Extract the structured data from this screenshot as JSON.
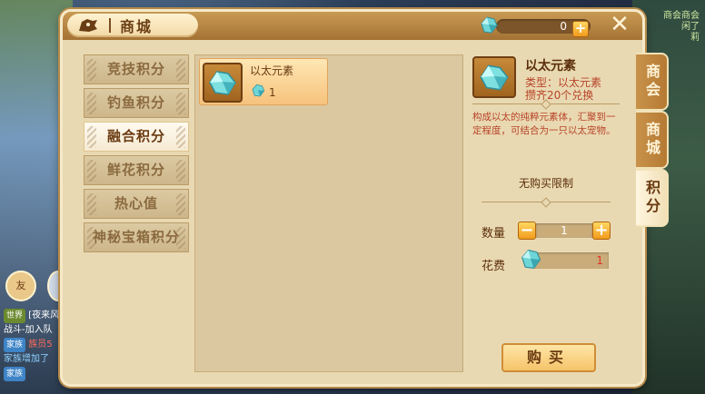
{
  "background": {
    "avatar_label": "友",
    "top_right_lines": [
      "商会商会",
      "闲了",
      "莉"
    ],
    "chat": [
      {
        "tag": "世界",
        "text": "[夜来风",
        "tag_type": "world"
      },
      {
        "tag": "",
        "text": "战斗-加入队",
        "tag_type": ""
      },
      {
        "tag": "家族",
        "text": "族员5",
        "tag_type": "family"
      },
      {
        "tag": "",
        "text": "家族增加了",
        "tag_type": ""
      },
      {
        "tag": "家族",
        "text": "",
        "tag_type": "family"
      }
    ]
  },
  "header": {
    "title": "商城",
    "currency_value": "0"
  },
  "categories": [
    {
      "label": "竞技积分",
      "active": false
    },
    {
      "label": "钓鱼积分",
      "active": false
    },
    {
      "label": "融合积分",
      "active": true
    },
    {
      "label": "鲜花积分",
      "active": false
    },
    {
      "label": "热心值",
      "active": false
    },
    {
      "label": "神秘宝箱积分",
      "active": false
    }
  ],
  "items": [
    {
      "name": "以太元素",
      "price": "1"
    }
  ],
  "detail": {
    "name": "以太元素",
    "type_line": "类型：以太元素",
    "redeem_line": "攒齐20个兑换",
    "description": "构成以太的纯粹元素体，汇聚到一定程度，可结合为一只以太宠物。",
    "limit": "无购买限制",
    "qty_label": "数量",
    "qty_value": "1",
    "cost_label": "花费",
    "cost_value": "1",
    "buy_label": "购买"
  },
  "side_tabs": [
    {
      "label": "商会",
      "active": false
    },
    {
      "label": "商城",
      "active": false
    },
    {
      "label": "积分",
      "active": true
    }
  ],
  "colors": {
    "accent": "#f19b1d",
    "panel": "#e9d9b2",
    "price_red": "#e0342a",
    "desc_red": "#b8442a"
  }
}
